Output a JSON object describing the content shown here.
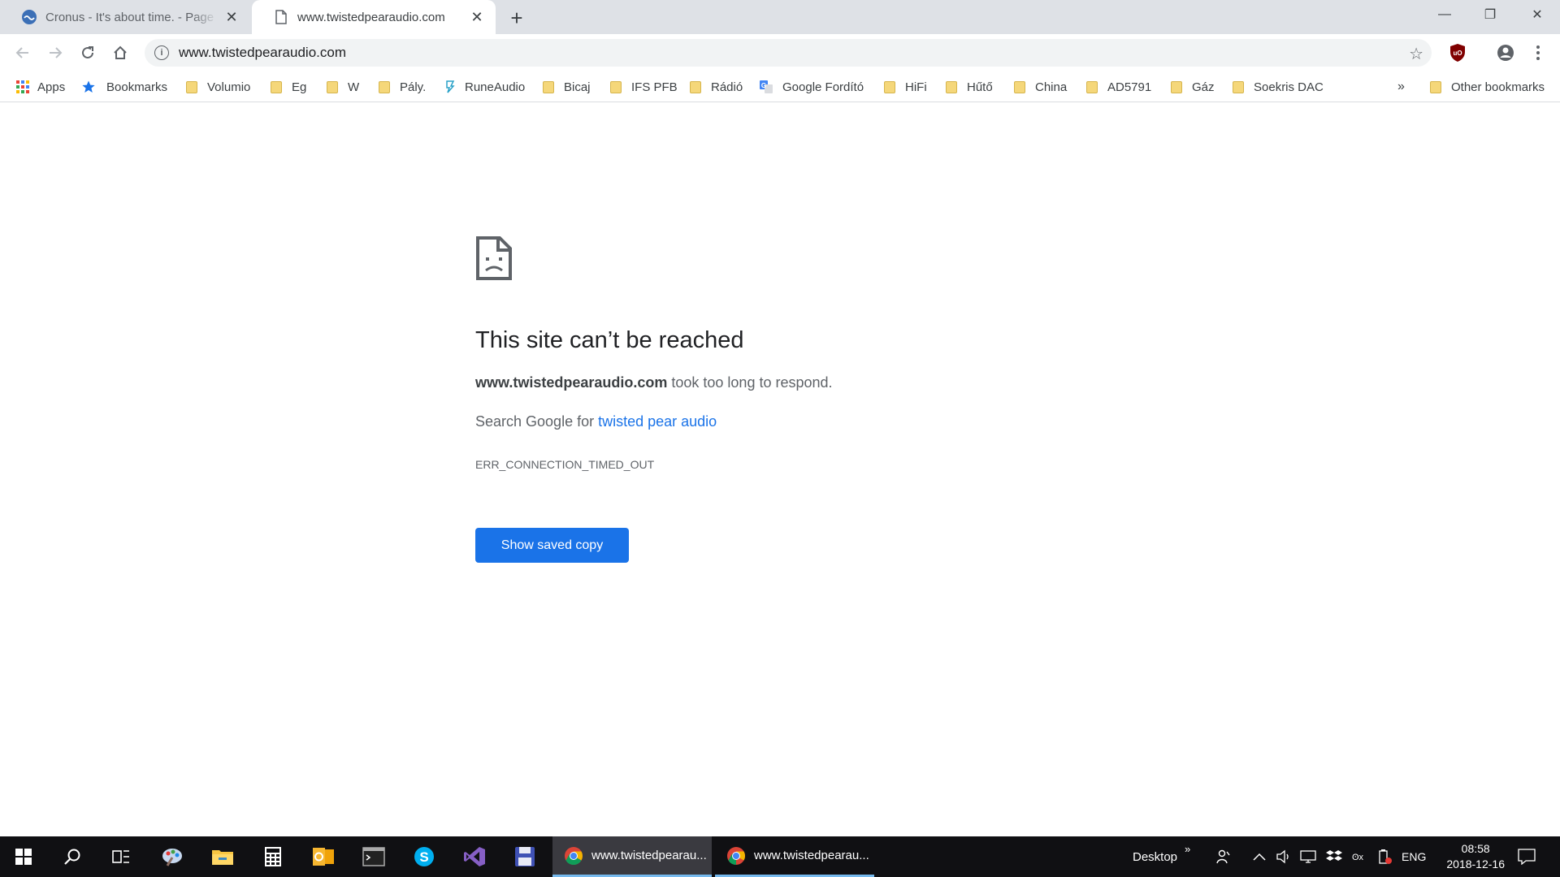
{
  "tabs": [
    {
      "title": "Cronus - It's about time. - Page 7",
      "close": "✕"
    },
    {
      "title": "www.twistedpearaudio.com",
      "close": "✕"
    }
  ],
  "new_tab": "+",
  "window_controls": {
    "minimize": "—",
    "maximize": "❐",
    "close": "✕"
  },
  "address_bar": {
    "url": "www.twistedpearaudio.com"
  },
  "bookmarks": [
    {
      "label": "Apps",
      "icon": "apps-grid-icon"
    },
    {
      "label": "Bookmarks",
      "icon": "star-icon"
    },
    {
      "label": "Volumio",
      "icon": "folder-icon"
    },
    {
      "label": "Eg",
      "icon": "folder-icon"
    },
    {
      "label": "W",
      "icon": "folder-icon"
    },
    {
      "label": "Pály.",
      "icon": "folder-icon"
    },
    {
      "label": "RuneAudio",
      "icon": "runeaudio-icon"
    },
    {
      "label": "Bicaj",
      "icon": "folder-icon"
    },
    {
      "label": "IFS PFB",
      "icon": "folder-icon"
    },
    {
      "label": "Rádió",
      "icon": "folder-icon"
    },
    {
      "label": "Google Fordító",
      "icon": "google-translate-icon"
    },
    {
      "label": "HiFi",
      "icon": "folder-icon"
    },
    {
      "label": "Hűtő",
      "icon": "folder-icon"
    },
    {
      "label": "China",
      "icon": "folder-icon"
    },
    {
      "label": "AD5791",
      "icon": "folder-icon"
    },
    {
      "label": "Gáz",
      "icon": "folder-icon"
    },
    {
      "label": "Soekris DAC",
      "icon": "folder-icon"
    }
  ],
  "bookmarks_overflow": "»",
  "other_bookmarks": "Other bookmarks",
  "error_page": {
    "title": "This site can’t be reached",
    "host": "www.twistedpearaudio.com",
    "detail_suffix": " took too long to respond.",
    "suggest_prefix": "Search Google for ",
    "suggest_link": "twisted pear audio",
    "error_code": "ERR_CONNECTION_TIMED_OUT",
    "button": "Show saved copy"
  },
  "taskbar": {
    "tasks": [
      {
        "title": "www.twistedpearau..."
      },
      {
        "title": "www.twistedpearau..."
      }
    ],
    "desktop_label": "Desktop",
    "desktop_chevron": "»",
    "language": "ENG",
    "time": "08:58",
    "date": "2018-12-16"
  },
  "colors": {
    "accent": "#1a73e8",
    "tabstrip": "#dee1e6",
    "taskbar": "#101013"
  }
}
